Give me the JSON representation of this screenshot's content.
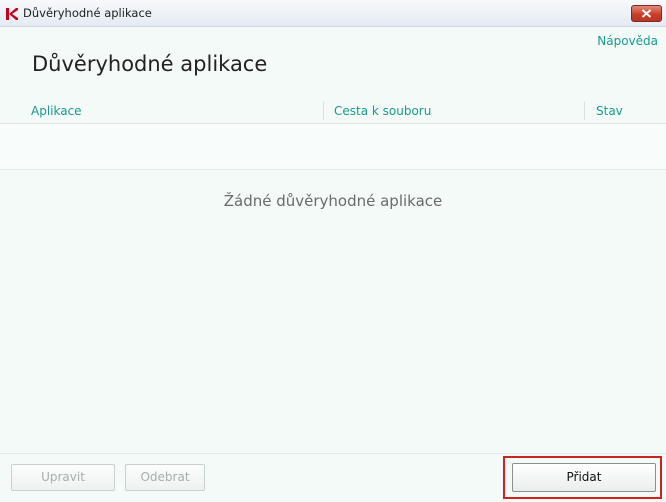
{
  "window": {
    "title": "Důvěryhodné aplikace"
  },
  "header": {
    "help_link": "Nápověda",
    "page_title": "Důvěryhodné aplikace"
  },
  "table": {
    "columns": [
      "Aplikace",
      "Cesta k souboru",
      "Stav"
    ],
    "empty_message": "Žádné důvěryhodné aplikace"
  },
  "footer": {
    "edit_label": "Upravit",
    "remove_label": "Odebrat",
    "add_label": "Přidat"
  },
  "colors": {
    "accent": "#1a9a8e",
    "background": "#f3faf7",
    "highlight": "#d02020",
    "close_button": "#c9402c"
  },
  "icons": {
    "app_logo": "kaspersky-logo-icon",
    "close": "close-icon"
  }
}
